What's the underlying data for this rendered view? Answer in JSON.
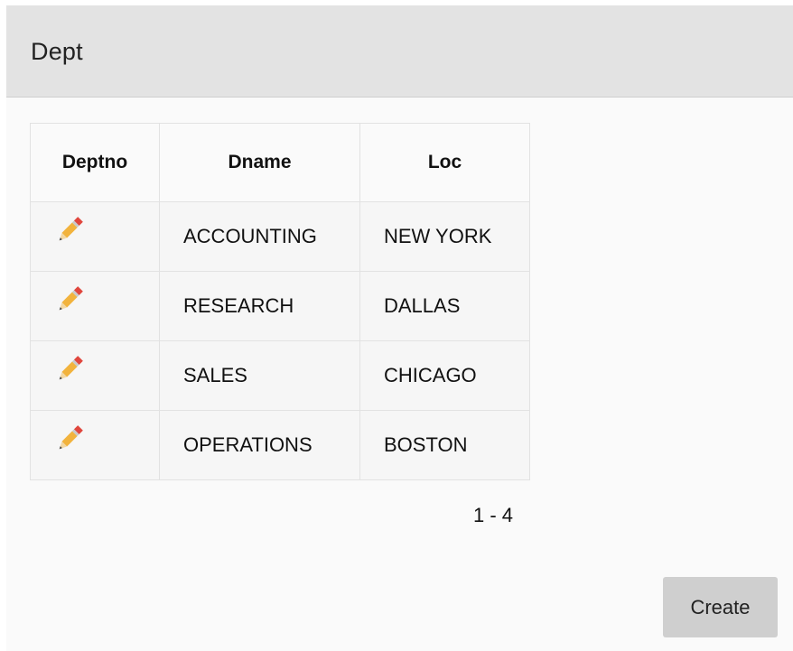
{
  "region": {
    "title": "Dept"
  },
  "report": {
    "columns": [
      "Deptno",
      "Dname",
      "Loc"
    ],
    "rows": [
      {
        "edit_icon": "pencil-icon",
        "dname": "ACCOUNTING",
        "loc": "NEW YORK"
      },
      {
        "edit_icon": "pencil-icon",
        "dname": "RESEARCH",
        "loc": "DALLAS"
      },
      {
        "edit_icon": "pencil-icon",
        "dname": "SALES",
        "loc": "CHICAGO"
      },
      {
        "edit_icon": "pencil-icon",
        "dname": "OPERATIONS",
        "loc": "BOSTON"
      }
    ],
    "pagination": "1 - 4"
  },
  "buttons": {
    "create_label": "Create"
  },
  "colors": {
    "header_bg": "#e3e3e3",
    "body_bg": "#fafafa",
    "button_bg": "#cfcfcf",
    "pencil_body": "#f2b33d",
    "pencil_eraser": "#e0463d"
  }
}
